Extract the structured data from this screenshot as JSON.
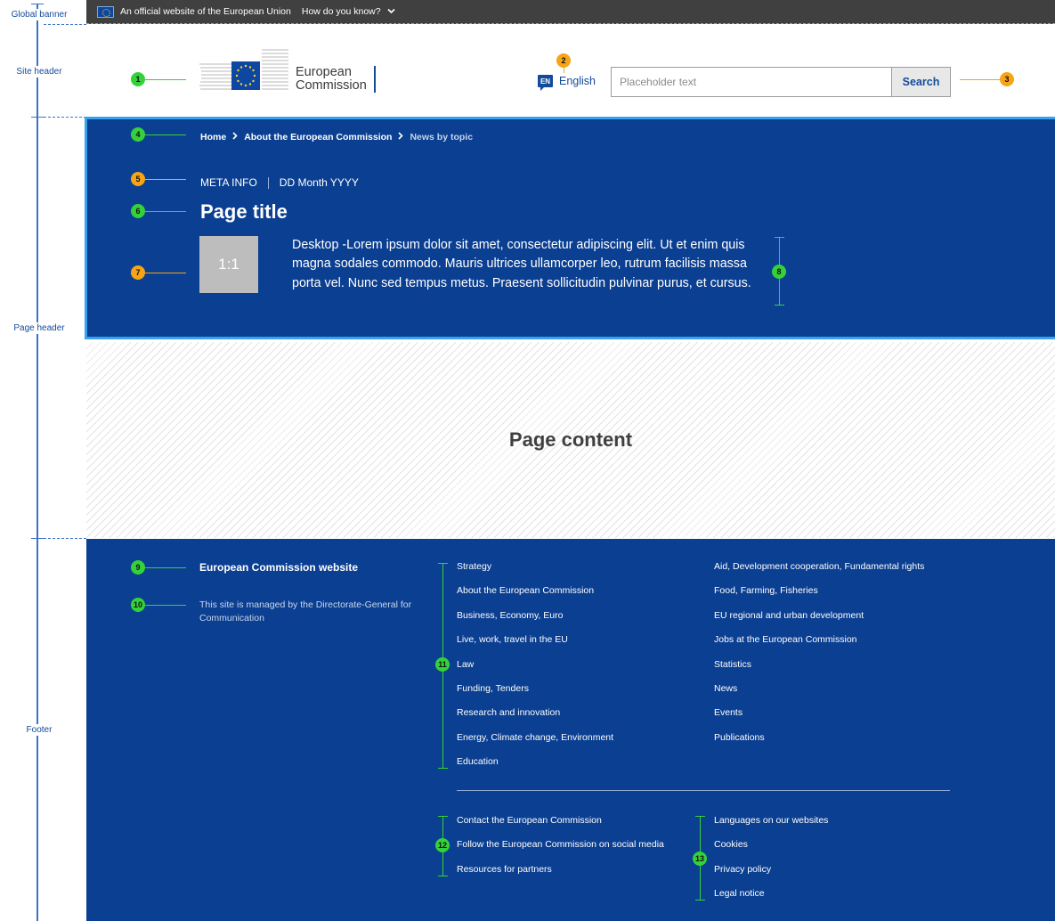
{
  "annotations": {
    "sections": [
      "Global banner",
      "Site header",
      "Page header",
      "Footer"
    ],
    "markers": [
      "1",
      "2",
      "3",
      "4",
      "5",
      "6",
      "7",
      "8",
      "9",
      "10",
      "11",
      "12",
      "13"
    ]
  },
  "global_banner": {
    "icon": "eu-flag-icon",
    "text": "An official website of the European Union",
    "question": "How do you know?",
    "chevron_icon": "chevron-down-icon"
  },
  "site_header": {
    "logo_line1": "European",
    "logo_line2": "Commission",
    "language_code": "EN",
    "language": "English",
    "search_placeholder": "Placeholder text",
    "search_button": "Search"
  },
  "page_header": {
    "breadcrumb": [
      {
        "label": "Home"
      },
      {
        "label": "About the European Commission"
      },
      {
        "label": "News by topic"
      }
    ],
    "meta": [
      "META INFO",
      "DD Month YYYY"
    ],
    "title": "Page title",
    "thumbnail_label": "1:1",
    "intro": "Desktop -Lorem ipsum dolor sit amet, consectetur adipiscing elit. Ut et enim quis magna sodales commodo. Mauris ultrices ullamcorper leo, rutrum facilisis massa porta vel. Nunc sed tempus metus. Praesent sollicitudin pulvinar purus, et cursus."
  },
  "page_content": {
    "label": "Page content"
  },
  "footer": {
    "site_name": "European Commission website",
    "description": "This site is managed by the Directorate-General for Communication",
    "topics_col1": [
      "Strategy",
      "About the European Commission",
      "Business, Economy, Euro",
      "Live, work, travel in the EU",
      "Law",
      "Funding, Tenders",
      "Research and innovation",
      "Energy, Climate change, Environment",
      "Education"
    ],
    "topics_col2": [
      "Aid, Development cooperation, Fundamental rights",
      "Food, Farming, Fisheries",
      "EU regional and urban development",
      "Jobs at the European Commission",
      "Statistics",
      "News",
      "Events",
      "Publications"
    ],
    "service_col1": [
      "Contact the European Commission",
      "Follow the European Commission on social media",
      "Resources for partners"
    ],
    "service_col2": [
      "Languages on our websites",
      "Cookies",
      "Privacy policy",
      "Legal notice"
    ]
  },
  "colors": {
    "ec_blue": "#0b3f91",
    "header_border": "#39a2ef",
    "banner_grey": "#404040",
    "annotation_green": "#35d13a",
    "annotation_orange": "#f7a416"
  }
}
